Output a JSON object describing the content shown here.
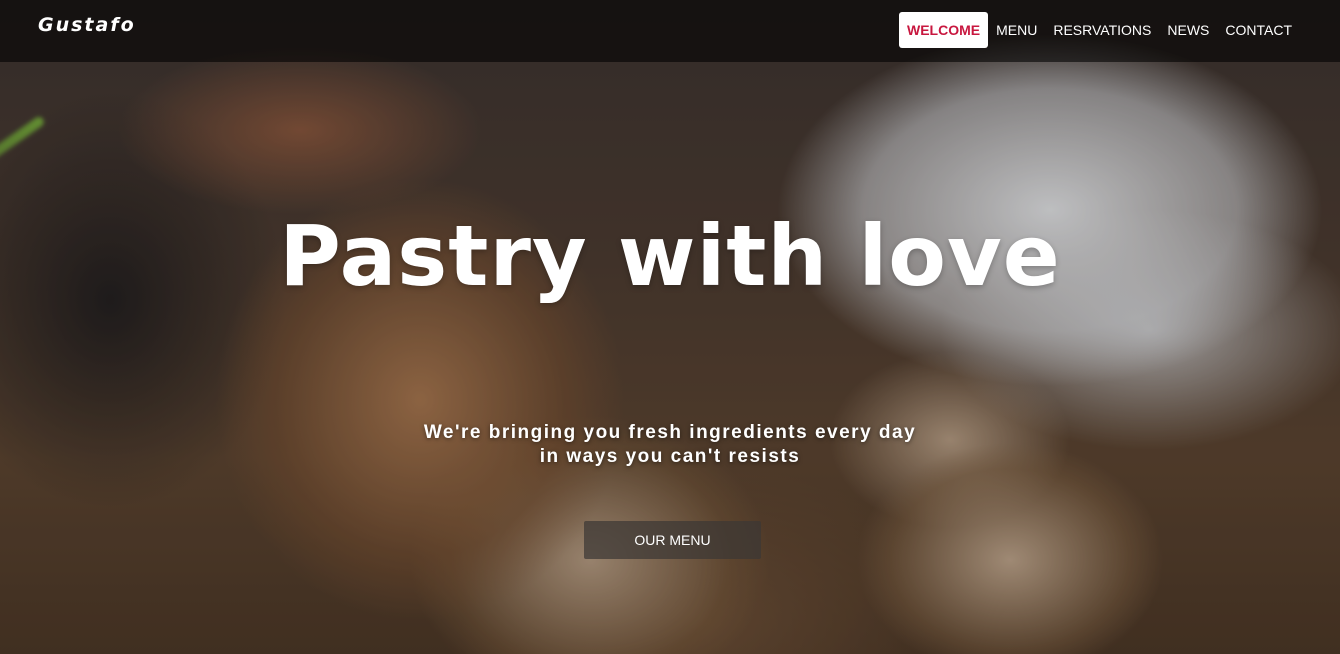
{
  "brand": {
    "name": "Gustafo"
  },
  "nav": {
    "items": [
      {
        "label": "WELCOME",
        "active": true
      },
      {
        "label": "MENU",
        "active": false
      },
      {
        "label": "RESRVATIONS",
        "active": false
      },
      {
        "label": "NEWS",
        "active": false
      },
      {
        "label": "CONTACT",
        "active": false
      }
    ]
  },
  "hero": {
    "headline": "Pastry with love",
    "tagline": "We're bringing you fresh ingredients every day in ways you can't resists",
    "cta_label": "OUR MENU",
    "background_icon": "bread-photo"
  },
  "colors": {
    "accent": "#c8173f",
    "navbar_bg": "rgba(0,0,0,0.58)",
    "text": "#ffffff"
  }
}
